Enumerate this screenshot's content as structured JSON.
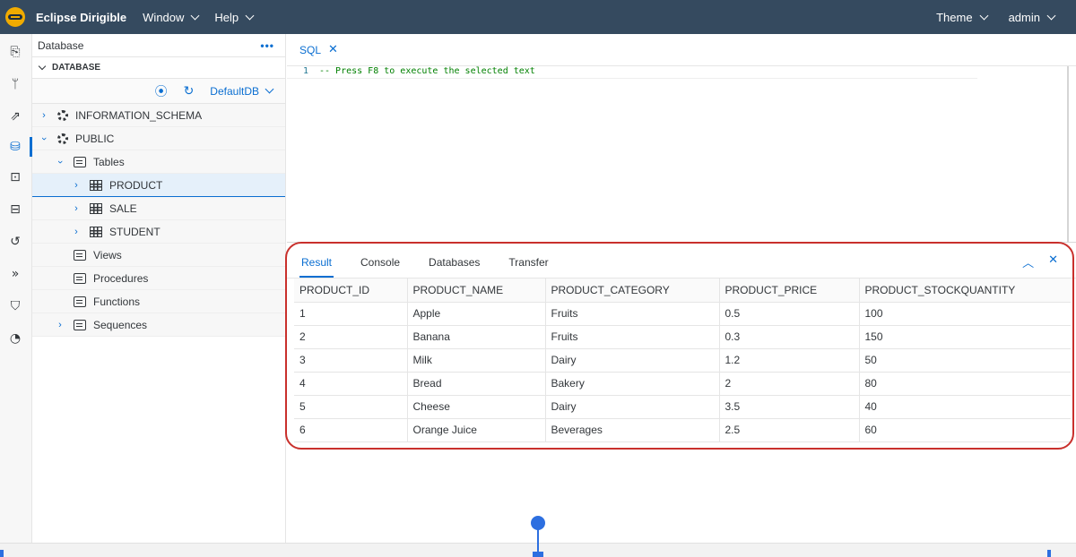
{
  "header": {
    "app_title": "Eclipse Dirigible",
    "menus": [
      "Window",
      "Help"
    ],
    "theme_label": "Theme",
    "user_label": "admin"
  },
  "activity_bar": {
    "icons": [
      "projects-icon",
      "git-icon",
      "deploy-icon",
      "database-icon",
      "terminal-icon",
      "inbox-icon",
      "history-icon",
      "pipeline-icon",
      "security-icon",
      "monitor-icon"
    ],
    "active": "database-icon"
  },
  "explorer": {
    "title": "Database",
    "more_label": "•••",
    "section_label": "DATABASE",
    "datasource": "DefaultDB",
    "tree": [
      {
        "label": "INFORMATION_SCHEMA",
        "icon": "schema-icon",
        "level": 0,
        "expander": "collapsed"
      },
      {
        "label": "PUBLIC",
        "icon": "schema-icon",
        "level": 0,
        "expander": "expanded"
      },
      {
        "label": "Tables",
        "icon": "folder-icon",
        "level": 1,
        "expander": "expanded"
      },
      {
        "label": "PRODUCT",
        "icon": "table-icon",
        "level": 2,
        "expander": "collapsed",
        "selected": true
      },
      {
        "label": "SALE",
        "icon": "table-icon",
        "level": 2,
        "expander": "collapsed"
      },
      {
        "label": "STUDENT",
        "icon": "table-icon",
        "level": 2,
        "expander": "collapsed"
      },
      {
        "label": "Views",
        "icon": "folder-icon",
        "level": 1,
        "expander": "none"
      },
      {
        "label": "Procedures",
        "icon": "folder-icon",
        "level": 1,
        "expander": "none"
      },
      {
        "label": "Functions",
        "icon": "folder-icon",
        "level": 1,
        "expander": "none"
      },
      {
        "label": "Sequences",
        "icon": "folder-icon",
        "level": 1,
        "expander": "collapsed"
      }
    ]
  },
  "editor": {
    "tab_label": "SQL",
    "lines": [
      {
        "number": "1",
        "text": "-- Press F8 to execute the selected text"
      }
    ]
  },
  "results": {
    "tabs": [
      "Result",
      "Console",
      "Databases",
      "Transfer"
    ],
    "active_tab": "Result",
    "columns": [
      "PRODUCT_ID",
      "PRODUCT_NAME",
      "PRODUCT_CATEGORY",
      "PRODUCT_PRICE",
      "PRODUCT_STOCKQUANTITY"
    ],
    "rows": [
      [
        "1",
        "Apple",
        "Fruits",
        "0.5",
        "100"
      ],
      [
        "2",
        "Banana",
        "Fruits",
        "0.3",
        "150"
      ],
      [
        "3",
        "Milk",
        "Dairy",
        "1.2",
        "50"
      ],
      [
        "4",
        "Bread",
        "Bakery",
        "2",
        "80"
      ],
      [
        "5",
        "Cheese",
        "Dairy",
        "3.5",
        "40"
      ],
      [
        "6",
        "Orange Juice",
        "Beverages",
        "2.5",
        "60"
      ]
    ]
  },
  "colors": {
    "shell": "#354a5f",
    "accent": "#0a6ed1",
    "highlight_ring": "#c9302c",
    "annotation": "#2d6fe0"
  }
}
